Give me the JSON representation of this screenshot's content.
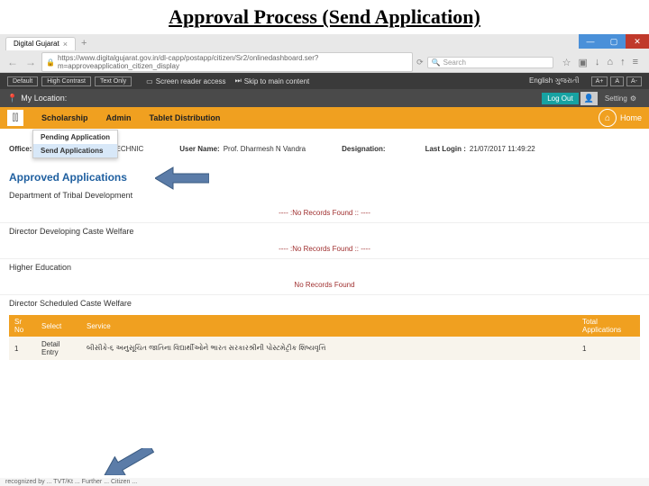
{
  "slide_title": "Approval Process (Send Application)",
  "browser": {
    "tab_title": "Digital Gujarat",
    "tab_plus": "+",
    "url": "https://www.digitalgujarat.gov.in/dl-capp/postapp/citizen/Sr2/onlinedashboard.ser?m=approveapplication_citizen_display",
    "search_placeholder": "Search",
    "nav_back": "←",
    "nav_fwd": "→",
    "refresh": "⟳"
  },
  "toolbar": [
    "☆",
    "▣",
    "↓",
    "⌂",
    "↑",
    "≡"
  ],
  "accessibility": {
    "default": "Default",
    "high_contrast": "High Contrast",
    "text_only": "Text Only",
    "screen_reader": "Screen reader access",
    "skip": "Skip to main content",
    "lang": "English ગુજરાતી",
    "font_plus": "A+",
    "font_normal": "A",
    "font_minus": "A-"
  },
  "location": {
    "label": "My Location:",
    "logout": "Log Out",
    "setting": "Setting"
  },
  "nav": {
    "items": [
      "Scholarship",
      "Admin",
      "Tablet Distribution"
    ],
    "home": "Home",
    "dropdown": {
      "pending": "Pending Application",
      "send": "Send Applications"
    }
  },
  "info": {
    "office_label": "Office:",
    "office_value": "SHREE K.J. FAN POLYTECHNIC",
    "user_label": "User Name:",
    "user_value": "Prof. Dharmesh N Vandra",
    "designation_label": "Designation:",
    "designation_value": "",
    "last_login_label": "Last Login :",
    "last_login_value": "21/07/2017 11:49:22"
  },
  "sections": {
    "approved_title": "Approved Applications",
    "depts": [
      {
        "name": "Department of Tribal Development",
        "msg": "---- :No Records Found :: ----"
      },
      {
        "name": "Director Developing Caste Welfare",
        "msg": "---- :No Records Found :: ----"
      },
      {
        "name": "Higher Education",
        "msg": "No Records Found"
      },
      {
        "name": "Director Scheduled Caste Welfare",
        "msg": null
      }
    ]
  },
  "table": {
    "headers": [
      "Sr No",
      "Select",
      "Service",
      "Total Applications"
    ],
    "row": {
      "srno": "1",
      "select": "Detail Entry",
      "service": "બીસીકે-૬ અનુસૂચિત જાતિના વિદ્યાર્થીઓને ભારત સરકારશ્રીની પોસ્ટમેટ્રીક શિષ્યવૃત્તિ",
      "total": "1"
    }
  },
  "footer": "recognized by ... TVT/Kt ... Further ... Citizen ..."
}
